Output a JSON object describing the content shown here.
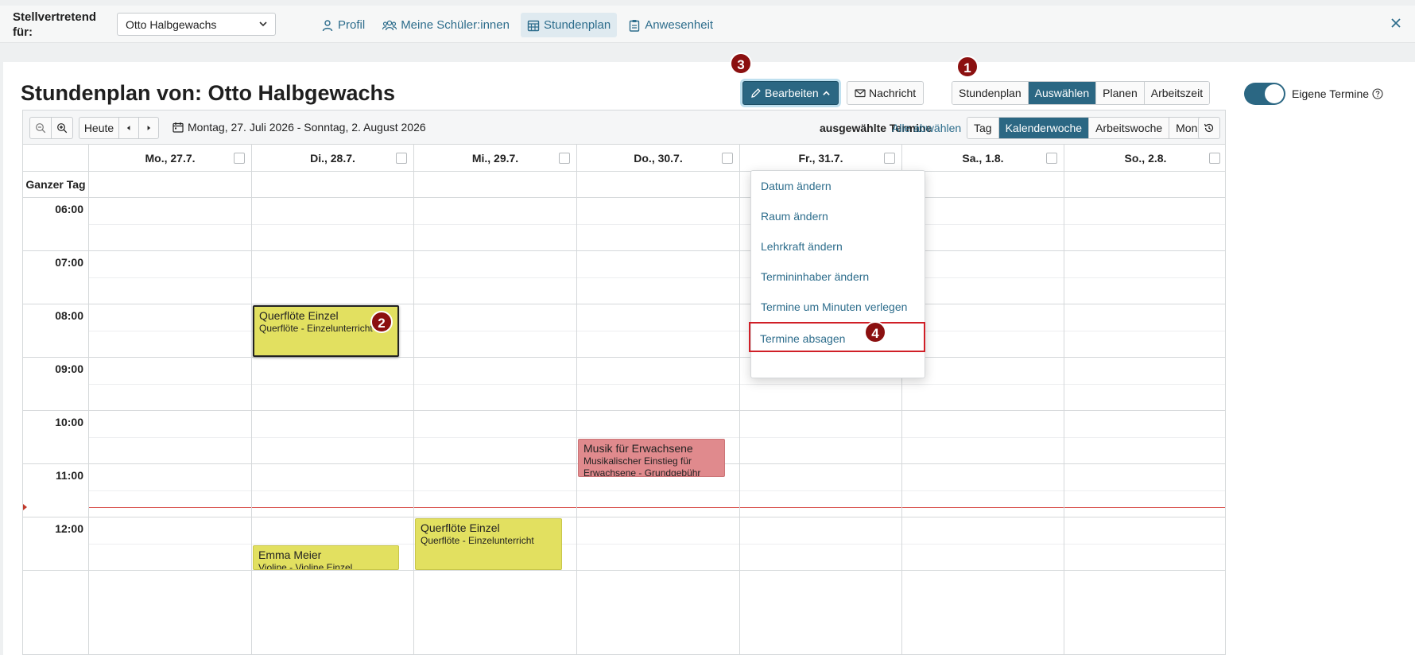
{
  "topbar": {
    "substitute_label": "Stellvertretend für:",
    "substitute_selected": "Otto Halbgewachs",
    "nav": [
      {
        "label": "Profil",
        "icon": "user-icon",
        "active": false
      },
      {
        "label": "Meine Schüler:innen",
        "icon": "users-icon",
        "active": false
      },
      {
        "label": "Stundenplan",
        "icon": "calendar-grid-icon",
        "active": true
      },
      {
        "label": "Anwesenheit",
        "icon": "clipboard-icon",
        "active": false
      }
    ]
  },
  "page": {
    "title": "Stundenplan von: Otto Halbgewachs",
    "edit_label": "Bearbeiten",
    "message_label": "Nachricht",
    "modes": [
      "Stundenplan",
      "Auswählen",
      "Planen",
      "Arbeitszeit"
    ],
    "active_mode": "Auswählen",
    "own_events_label": "Eigene Termine",
    "own_events_on": true
  },
  "calendar": {
    "today_label": "Heute",
    "range": "Montag, 27. Juli 2026 - Sonntag, 2. August 2026",
    "selected_label": "ausgewählte Termine",
    "deselect_label": "Alle abwählen",
    "views": [
      "Tag",
      "Kalenderwoche",
      "Arbeitswoche",
      "Monat"
    ],
    "active_view": "Kalenderwoche",
    "allday_label": "Ganzer Tag",
    "days": [
      "Mo., 27.7.",
      "Di., 28.7.",
      "Mi., 29.7.",
      "Do., 30.7.",
      "Fr., 31.7.",
      "Sa., 1.8.",
      "So., 2.8."
    ],
    "hours": [
      "06:00",
      "07:00",
      "08:00",
      "09:00",
      "10:00",
      "11:00",
      "12:00"
    ],
    "events": [
      {
        "title": "Querflöte Einzel",
        "subtitle": "Querflöte - Einzelunterricht",
        "day": 1,
        "start": "08:00",
        "end": "09:00",
        "color": "#e2e060",
        "selected": true
      },
      {
        "title": "Musik für Erwachsene",
        "subtitle": "Musikalischer Einstieg für Erwachsene - Grundgebühr",
        "day": 3,
        "start": "10:30",
        "end": "11:15",
        "color": "#e08a8d",
        "selected": false
      },
      {
        "title": "Querflöte Einzel",
        "subtitle": "Querflöte - Einzelunterricht",
        "day": 2,
        "start": "12:00",
        "end": "13:00",
        "color": "#e2e060",
        "selected": false
      },
      {
        "title": "Emma Meier",
        "subtitle": "Violine - Violine Einzel",
        "day": 1,
        "start": "12:30",
        "end": "13:00",
        "color": "#e2e060",
        "selected": false
      }
    ]
  },
  "edit_menu": {
    "items": [
      "Datum ändern",
      "Raum ändern",
      "Lehrkraft ändern",
      "Termininhaber ändern",
      "Termine um Minuten verlegen",
      "Termine absagen"
    ],
    "highlighted": "Termine absagen"
  },
  "markers": [
    "1",
    "2",
    "3",
    "4"
  ],
  "colors": {
    "accent": "#2b6783",
    "link": "#2d6d8c",
    "marker": "#8b1010",
    "highlight": "#d01f27"
  }
}
